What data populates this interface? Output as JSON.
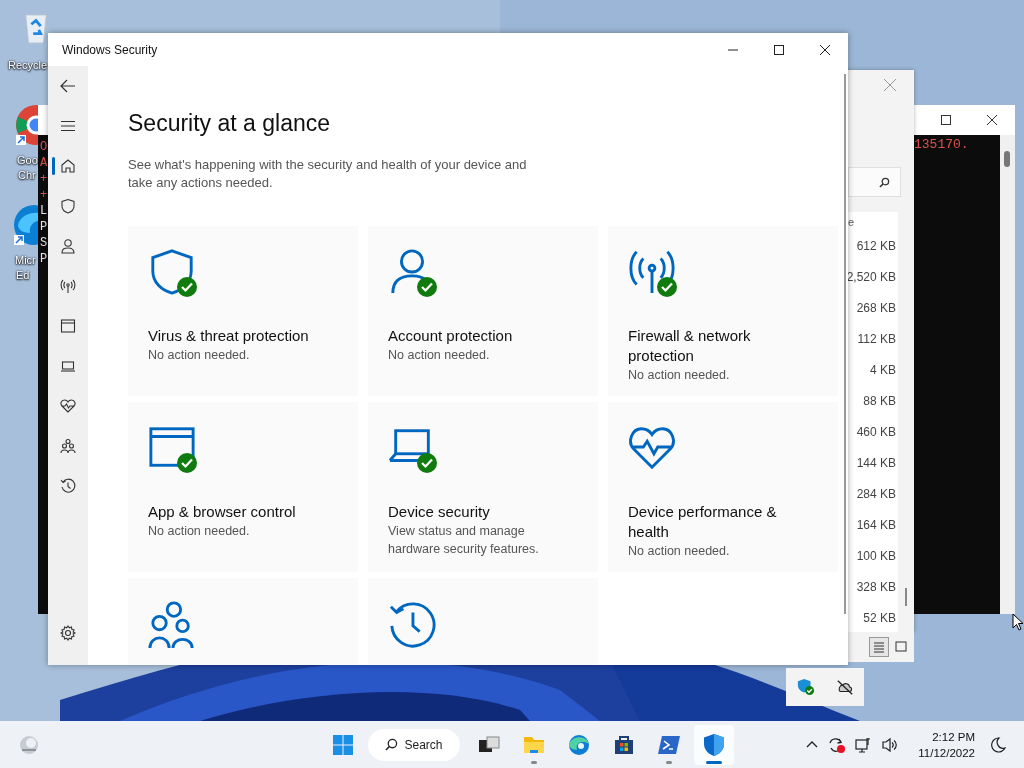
{
  "desktop_icons": [
    {
      "kind": "recycle",
      "lines": [
        "Recycle"
      ]
    },
    {
      "kind": "chrome",
      "lines": [
        "Goo",
        "Chr"
      ]
    },
    {
      "kind": "edge",
      "lines": [
        "Micr",
        "Ed"
      ]
    }
  ],
  "terminal": {
    "margin_lines": [
      {
        "text": "O",
        "color": "#d9534f"
      },
      {
        "text": "A",
        "color": "#d9534f"
      },
      {
        "text": "+",
        "color": "#d9534f"
      },
      {
        "text": "+",
        "color": "#d9534f"
      },
      {
        "text": "L",
        "color": "#e8e8e8"
      },
      {
        "text": "P",
        "color": "#e8e8e8"
      },
      {
        "text": "S",
        "color": "#e8e8e8"
      },
      {
        "text": "P",
        "color": "#e8e8e8"
      }
    ],
    "output": "135170."
  },
  "explorer": {
    "column_fragment": "e",
    "sizes": [
      "612 KB",
      "2,520 KB",
      "268 KB",
      "112 KB",
      "4 KB",
      "88 KB",
      "460 KB",
      "144 KB",
      "284 KB",
      "164 KB",
      "100 KB",
      "328 KB",
      "52 KB"
    ]
  },
  "security": {
    "title": "Windows Security",
    "nav": [
      {
        "kind": "home",
        "selected": true
      },
      {
        "kind": "shield",
        "selected": false
      },
      {
        "kind": "account",
        "selected": false
      },
      {
        "kind": "firewall",
        "selected": false
      },
      {
        "kind": "app",
        "selected": false
      },
      {
        "kind": "device",
        "selected": false
      },
      {
        "kind": "health",
        "selected": false
      },
      {
        "kind": "family",
        "selected": false
      },
      {
        "kind": "history",
        "selected": false
      }
    ],
    "heading": "Security at a glance",
    "subtitle": "See what's happening with the security and health of your device and take any actions needed.",
    "cards": [
      {
        "kind": "shield",
        "title": "Virus & threat protection",
        "status": "No action needed.",
        "ok": true
      },
      {
        "kind": "account",
        "title": "Account protection",
        "status": "No action needed.",
        "ok": true
      },
      {
        "kind": "firewall",
        "title": "Firewall & network protection",
        "status": "No action needed.",
        "ok": true
      },
      {
        "kind": "app",
        "title": "App & browser control",
        "status": "No action needed.",
        "ok": true
      },
      {
        "kind": "device",
        "title": "Device security",
        "status": "View status and manage hardware security features.",
        "ok": true
      },
      {
        "kind": "health",
        "title": "Device performance & health",
        "status": "No action needed.",
        "ok": false
      },
      {
        "kind": "family",
        "ok": false
      },
      {
        "kind": "history",
        "ok": false
      }
    ]
  },
  "taskbar": {
    "search": "Search",
    "apps": [
      {
        "kind": "taskview",
        "running": false,
        "selected": false
      },
      {
        "kind": "explorer",
        "running": true,
        "selected": false
      },
      {
        "kind": "edge",
        "running": false,
        "selected": false
      },
      {
        "kind": "store",
        "running": false,
        "selected": false
      },
      {
        "kind": "powershell",
        "running": true,
        "selected": false
      },
      {
        "kind": "security",
        "running": true,
        "selected": true
      }
    ],
    "time": "2:12 PM",
    "date": "11/12/2022"
  }
}
